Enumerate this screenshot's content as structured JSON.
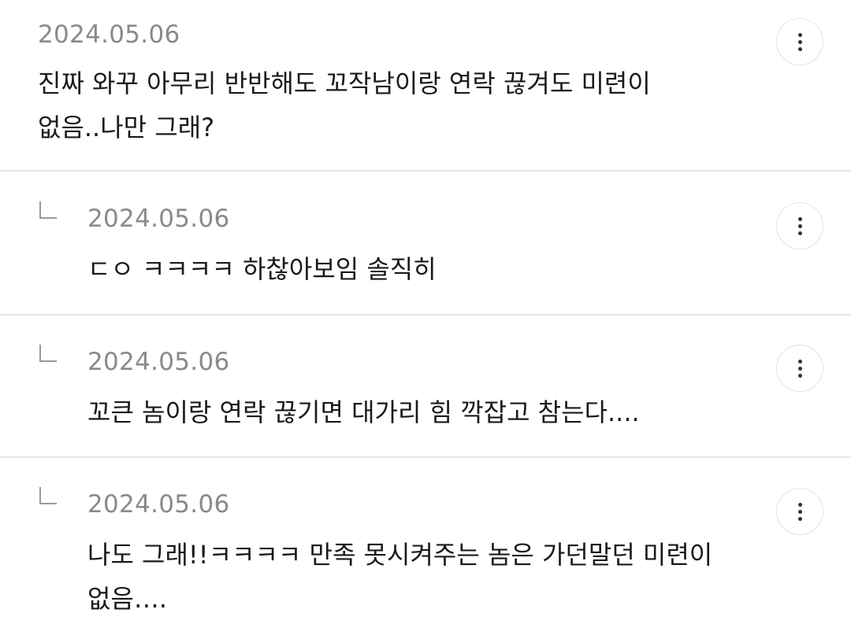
{
  "comments": [
    {
      "date": "2024.05.06",
      "text": "진짜 와꾸 아무리 반반해도 꼬작남이랑 연락 끊겨도 미련이\n없음..나만 그래?",
      "more_icon": "more-vertical-icon"
    },
    {
      "date": "2024.05.06",
      "text": "ㄷㅇ ㅋㅋㅋㅋ 하찮아보임 솔직히",
      "reply_icon": "reply-arrow-icon",
      "more_icon": "more-vertical-icon"
    },
    {
      "date": "2024.05.06",
      "text": "꼬큰 놈이랑 연락 끊기면 대가리 힘 깍잡고 참는다....",
      "reply_icon": "reply-arrow-icon",
      "more_icon": "more-vertical-icon"
    },
    {
      "date": "2024.05.06",
      "text": "나도 그래!!ㅋㅋㅋㅋ 만족 못시켜주는 놈은 가던말던 미련이\n없음….",
      "reply_icon": "reply-arrow-icon",
      "more_icon": "more-vertical-icon"
    }
  ]
}
